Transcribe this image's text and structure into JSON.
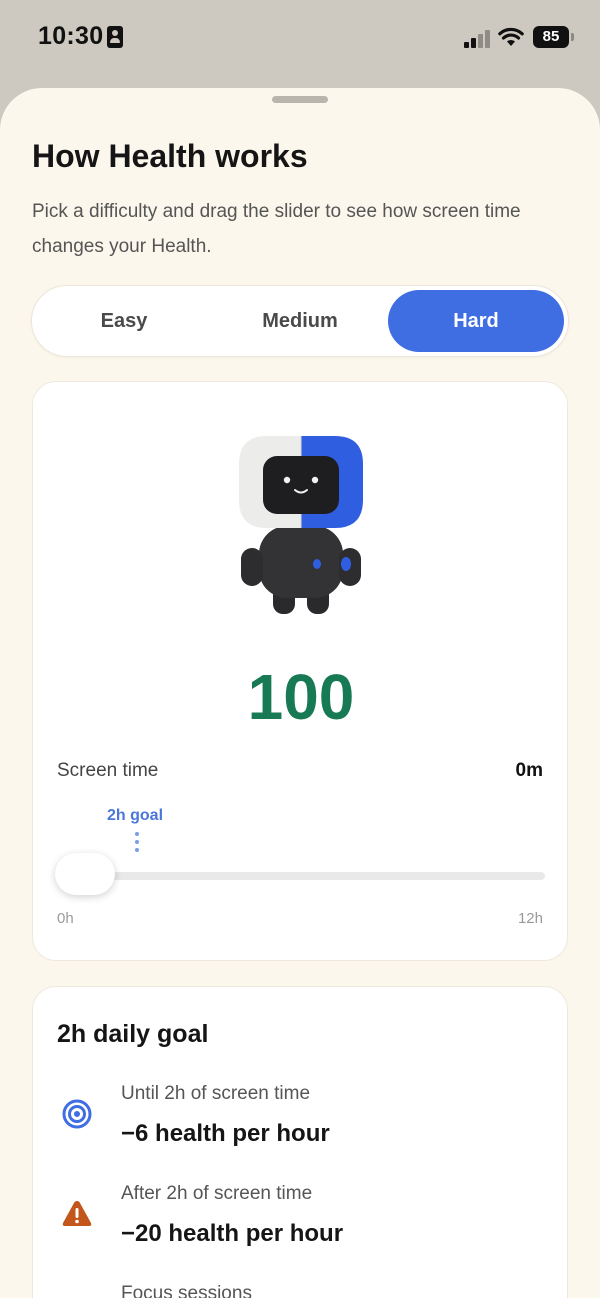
{
  "status_bar": {
    "time": "10:30",
    "battery_level": "85",
    "icons": [
      "id-card-icon",
      "cellular-signal-icon",
      "wifi-icon",
      "battery-icon"
    ]
  },
  "sheet": {
    "title": "How Health works",
    "subtitle": "Pick a difficulty and drag the slider to see how screen time changes your Health."
  },
  "difficulty": {
    "options": [
      "Easy",
      "Medium",
      "Hard"
    ],
    "selected": "Hard"
  },
  "simulator": {
    "score": "100",
    "score_color": "#177a55",
    "screen_time_label": "Screen time",
    "screen_time_value": "0m",
    "goal_marker_label": "2h goal",
    "slider_min_label": "0h",
    "slider_max_label": "12h",
    "slider_value_hours": 0,
    "slider_max_hours": 12,
    "goal_hours": 2
  },
  "goal_card": {
    "title": "2h daily goal",
    "rules": [
      {
        "icon": "target-icon",
        "label": "Until 2h of screen time",
        "value": "−6 health per hour"
      },
      {
        "icon": "warning-icon",
        "label": "After 2h of screen time",
        "value": "−20 health per hour"
      },
      {
        "label": "Focus sessions"
      }
    ]
  },
  "colors": {
    "accent": "#3f6ee3",
    "background": "#fcf7ec",
    "warning": "#c2561b"
  }
}
